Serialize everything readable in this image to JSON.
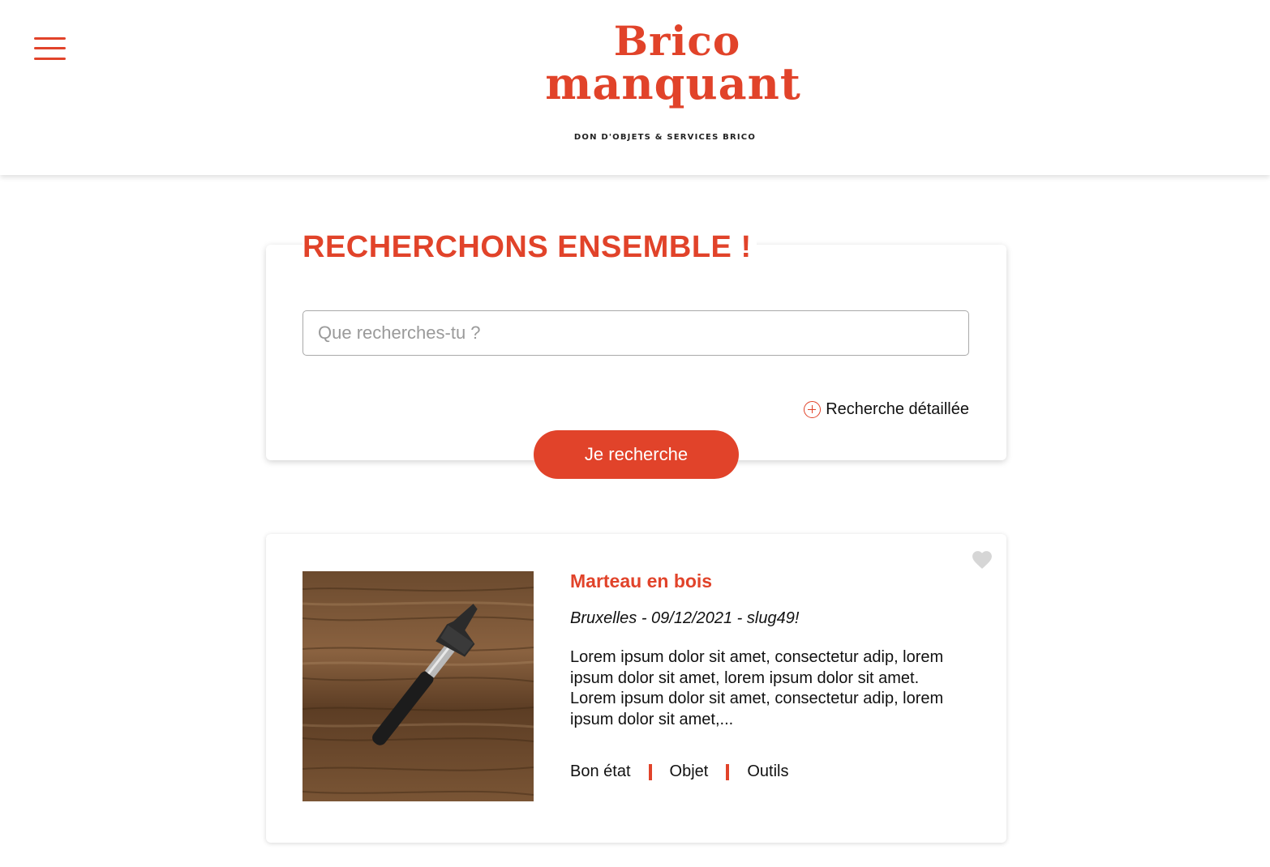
{
  "header": {
    "menu_icon": "hamburger-menu-icon",
    "logo_line1": "Brico",
    "logo_line2": "manquant",
    "tagline": "DON D'OBJETS & SERVICES BRICO"
  },
  "search": {
    "title": "RECHERCHONS ENSEMBLE !",
    "placeholder": "Que recherches-tu ?",
    "advanced_label": "Recherche détaillée",
    "advanced_icon": "plus-circle-icon",
    "button_label": "Je recherche"
  },
  "results": [
    {
      "title": "Marteau en bois",
      "meta": "Bruxelles - 09/12/2021 - slug49!",
      "description": "Lorem ipsum dolor sit amet, consectetur adip, lorem ipsum dolor sit amet, lorem ipsum dolor sit amet. Lorem ipsum dolor sit amet, consectetur adip, lorem ipsum dolor sit amet,...",
      "tags": [
        "Bon état",
        "Objet",
        "Outils"
      ],
      "image": "hammer-on-wood-photo",
      "favorite_icon": "heart-icon"
    }
  ],
  "colors": {
    "brand": "#e1432a",
    "text": "#111111",
    "muted": "#9a9a9a",
    "heart": "#d6d6d6"
  }
}
